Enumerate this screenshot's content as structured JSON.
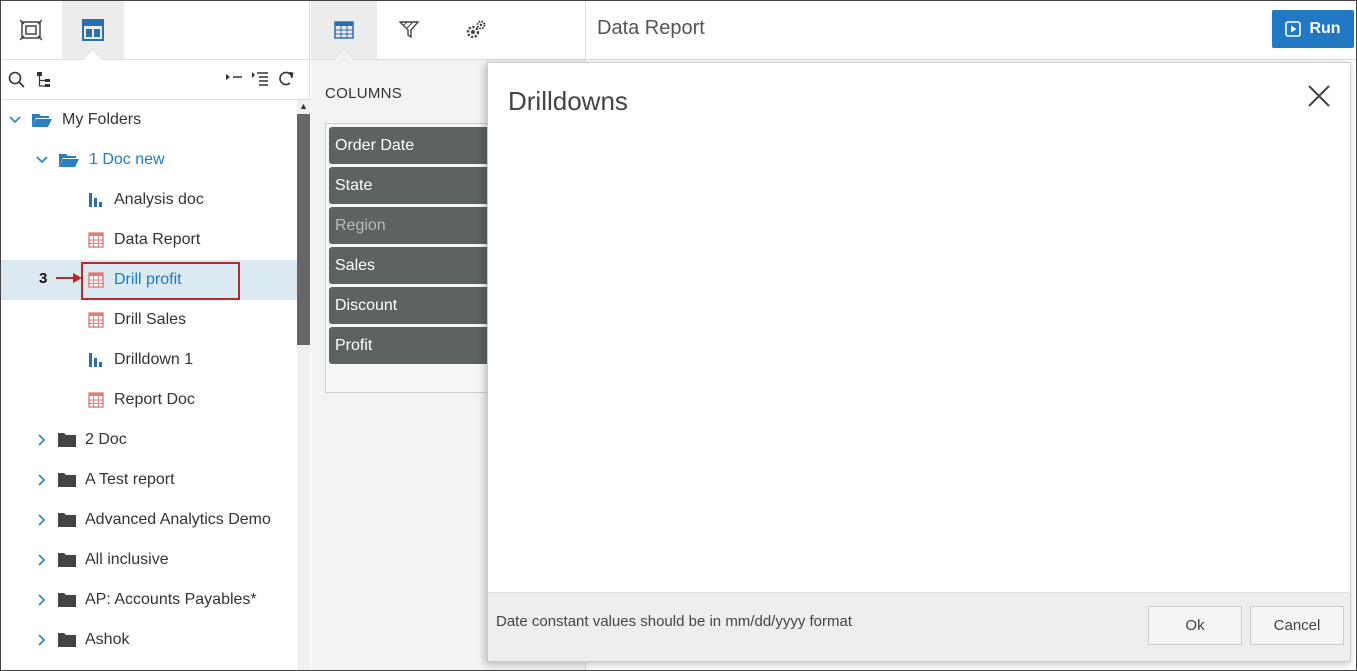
{
  "left_panel": {
    "tree_items": [
      {
        "label": "My Folders",
        "type": "folder-open",
        "expanded": true
      },
      {
        "label": "1 Doc new",
        "type": "folder-open",
        "expanded": true
      },
      {
        "label": "Analysis doc",
        "type": "chart-doc"
      },
      {
        "label": "Data Report",
        "type": "report-doc"
      },
      {
        "label": "Drill profit",
        "type": "report-doc",
        "selected": true
      },
      {
        "label": "Drill Sales",
        "type": "report-doc"
      },
      {
        "label": "Drilldown 1",
        "type": "chart-doc"
      },
      {
        "label": "Report Doc",
        "type": "report-doc"
      },
      {
        "label": "2 Doc",
        "type": "folder"
      },
      {
        "label": "A Test report",
        "type": "folder"
      },
      {
        "label": "Advanced Analytics Demo",
        "type": "folder"
      },
      {
        "label": "All inclusive",
        "type": "folder"
      },
      {
        "label": "AP: Accounts Payables*",
        "type": "folder"
      },
      {
        "label": "Ashok",
        "type": "folder"
      }
    ],
    "callout_number": "3"
  },
  "middle_panel": {
    "columns_title": "COLUMNS",
    "columns": [
      {
        "label": "Order Date"
      },
      {
        "label": "State"
      },
      {
        "label": "Region",
        "dimmed": true
      },
      {
        "label": "Sales"
      },
      {
        "label": "Discount"
      },
      {
        "label": "Profit"
      }
    ]
  },
  "header": {
    "report_title": "Data Report",
    "run_label": "Run"
  },
  "dialog": {
    "title": "Drilldowns",
    "footer_note": "Date constant values should be in mm/dd/yyyy format",
    "ok_label": "Ok",
    "cancel_label": "Cancel"
  },
  "colors": {
    "accent": "#2179c3",
    "selected_row": "#dbe9f3",
    "column_pill": "#5d6361",
    "callout_red": "#c0272d",
    "report_icon": "#e57a7a"
  }
}
